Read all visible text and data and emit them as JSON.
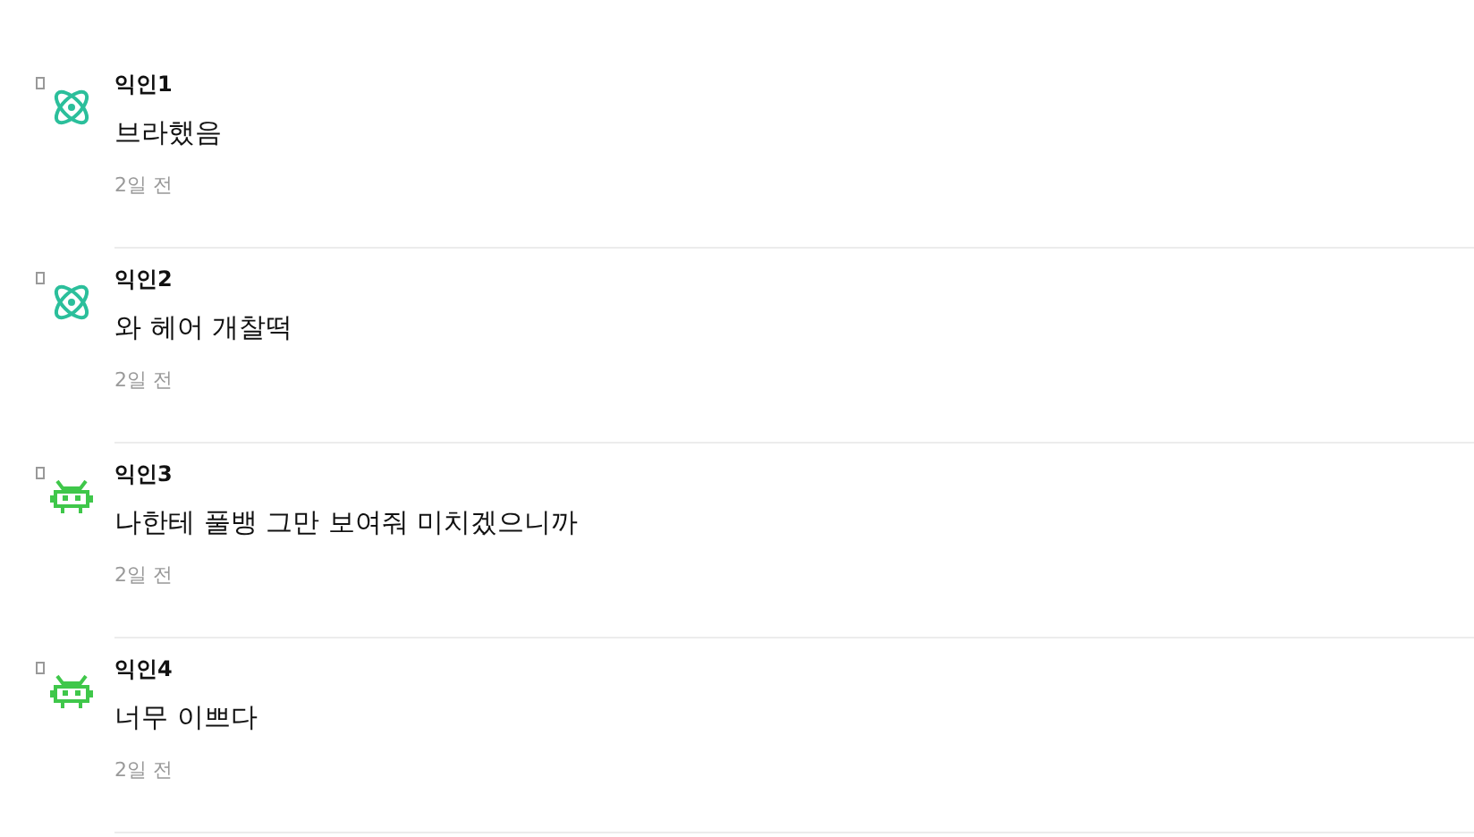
{
  "comments": [
    {
      "kind": "atom",
      "author": "익인1",
      "text": "브라했음",
      "time": "2일 전"
    },
    {
      "kind": "atom",
      "author": "익인2",
      "text": "와 헤어 개찰떡",
      "time": "2일 전"
    },
    {
      "kind": "creature",
      "author": "익인3",
      "text": "나한테 풀뱅 그만 보여줘 미치겠으니까",
      "time": "2일 전"
    },
    {
      "kind": "creature",
      "author": "익인4",
      "text": "너무 이쁘다",
      "time": "2일 전"
    }
  ]
}
